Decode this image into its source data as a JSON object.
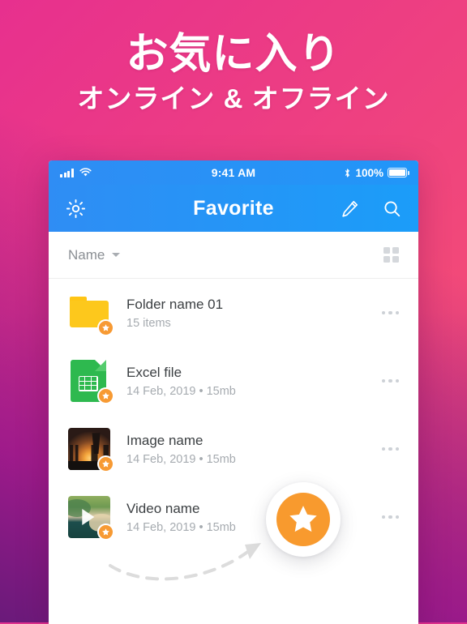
{
  "promo": {
    "title": "お気に入り",
    "subtitle": "オンライン & オフライン",
    "bg_start": "#e7308e",
    "bg_mid": "#f7566f",
    "bg_end": "#6a1a7a"
  },
  "status_bar": {
    "time": "9:41 AM",
    "battery_percent": "100%",
    "signal_icon": "cellular-signal-icon",
    "wifi_icon": "wifi-icon",
    "bluetooth_icon": "bluetooth-icon",
    "battery_icon": "battery-full-icon"
  },
  "app_bar": {
    "title": "Favorite",
    "settings_icon": "gear-icon",
    "edit_icon": "pencil-icon",
    "search_icon": "search-icon",
    "accent": "#2190f7"
  },
  "sort_bar": {
    "label": "Name",
    "caret_icon": "chevron-down-icon",
    "grid_toggle_icon": "grid-view-icon"
  },
  "files": [
    {
      "title": "Folder name 01",
      "meta": "15 items",
      "thumb": "folder-icon",
      "favorite": true,
      "menu_icon": "more-options-icon"
    },
    {
      "title": "Excel file",
      "meta": "14 Feb, 2019 • 15mb",
      "thumb": "spreadsheet-document-icon",
      "favorite": true,
      "menu_icon": "more-options-icon"
    },
    {
      "title": "Image name",
      "meta": "14 Feb, 2019 • 15mb",
      "thumb": "photo-thumbnail",
      "favorite": true,
      "menu_icon": "more-options-icon"
    },
    {
      "title": "Video name",
      "meta": "14 Feb, 2019 • 15mb",
      "thumb": "video-thumbnail",
      "favorite": true,
      "menu_icon": "more-options-icon"
    }
  ],
  "fab": {
    "icon": "star-icon",
    "color": "#f89a2e",
    "arrow_icon": "dashed-curved-arrow-icon"
  }
}
